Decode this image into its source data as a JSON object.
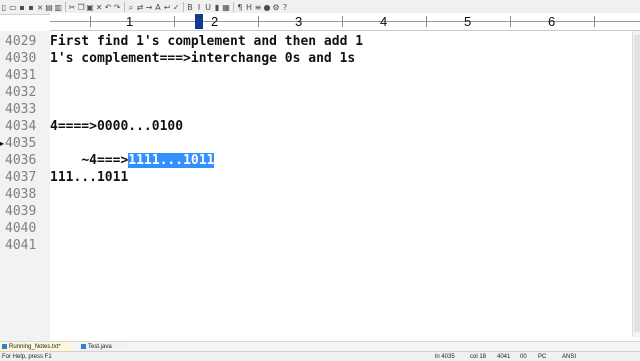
{
  "toolbar": {
    "icons": [
      "new-file-icon",
      "open-folder-icon",
      "save-icon",
      "save-all-icon",
      "close-file-icon",
      "print-icon",
      "print-preview-icon",
      "cut-icon",
      "copy-icon",
      "paste-icon",
      "delete-icon",
      "undo-icon",
      "redo-icon",
      "find-icon",
      "replace-icon",
      "goto-icon",
      "font-size-icon",
      "word-wrap-icon",
      "spell-check-icon",
      "bold-icon",
      "italic-icon",
      "underline-icon",
      "highlight-icon",
      "column-mode-icon",
      "whitespace-icon",
      "hex-mode-icon",
      "compare-icon",
      "macro-icon",
      "settings-icon",
      "help-icon"
    ]
  },
  "ruler": {
    "numbers": [
      "1",
      "2",
      "3",
      "4",
      "5",
      "6"
    ]
  },
  "editor": {
    "lines": [
      {
        "num": "4029",
        "text": "First find 1's complement and then add 1"
      },
      {
        "num": "4030",
        "text": "1's complement===>interchange 0s and 1s"
      },
      {
        "num": "4031",
        "text": ""
      },
      {
        "num": "4032",
        "text": ""
      },
      {
        "num": "4033",
        "text": ""
      },
      {
        "num": "4034",
        "text": "4====>0000...0100"
      },
      {
        "num": "4035",
        "text_before": "~4===>",
        "text_selected": "1111...1011"
      },
      {
        "num": "4036",
        "text": ""
      },
      {
        "num": "4037",
        "text": "111...1011"
      },
      {
        "num": "4038",
        "text": ""
      },
      {
        "num": "4039",
        "text": ""
      },
      {
        "num": "4040",
        "text": ""
      },
      {
        "num": "4041",
        "text": ""
      }
    ],
    "selection_color": "#3390ff",
    "gutter_text_color": "#7f7f7f"
  },
  "tabs": [
    {
      "label": "Running_Notes.txt*",
      "active": true
    },
    {
      "label": "Test.java",
      "active": false
    }
  ],
  "status": {
    "help": "For Help, press F1",
    "line": "ln 4035",
    "col": "col 18",
    "count": "4041",
    "code": "00",
    "eol": "PC",
    "encoding": "ANSI"
  }
}
